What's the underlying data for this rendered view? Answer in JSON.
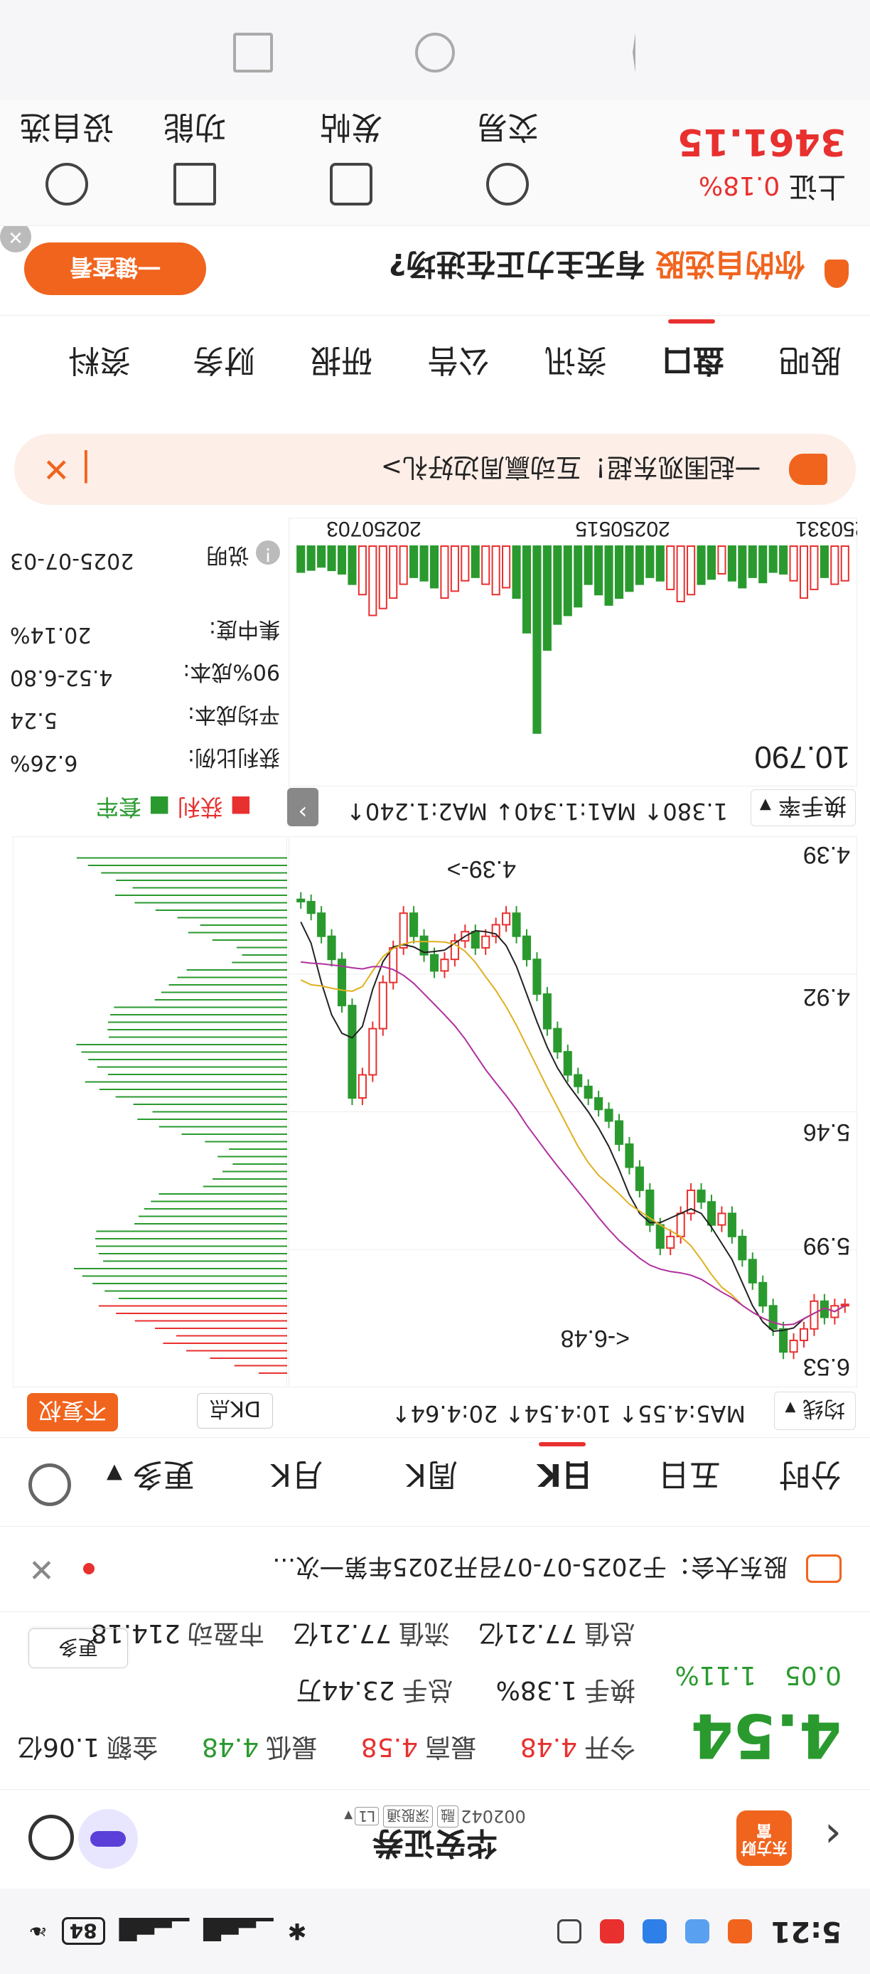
{
  "status": {
    "time": "5:21",
    "battery": "84"
  },
  "header": {
    "logo": "东方财富",
    "title": "华安证券",
    "code": "002042",
    "tags": [
      "融",
      "深股通",
      "L1"
    ],
    "back": "‹"
  },
  "quote": {
    "price": "4.54",
    "change": "0.05",
    "pct": "1.11%",
    "rows": [
      [
        [
          "今开",
          "4.48"
        ],
        [
          "最高",
          "4.58"
        ],
        [
          "最低",
          "4.48"
        ],
        [
          "金额",
          "1.06亿"
        ]
      ],
      [
        [
          "换手",
          "1.38%"
        ],
        [
          "总手",
          "23.44万"
        ],
        [
          "",
          "",
          ""
        ]
      ],
      [
        [
          "总值",
          "77.21亿"
        ],
        [
          "流值",
          "77.21亿"
        ],
        [
          "市盈动",
          "214.18"
        ]
      ]
    ],
    "more": "更多"
  },
  "notice": {
    "text": "股东大会：于2025-07-07召开2025年第一次..."
  },
  "period_tabs": {
    "items": [
      "分时",
      "五日",
      "日K",
      "周K",
      "月K",
      "更多"
    ],
    "active": "日K"
  },
  "ma": {
    "selector": "均线",
    "values": "MA5:4.55↑ 10:4.54↑ 20:4.64↑",
    "dk": "DK点",
    "fq": "不复权"
  },
  "kchart": {
    "max_label": "6.53",
    "mid1": "5.99",
    "mid2": "5.46",
    "mid3": "4.92",
    "min_label": "4.39",
    "hi_annot": "<-6.48",
    "lo_annot": "4.39->"
  },
  "chip": {
    "legend_profit": "获利",
    "legend_trap": "套牢"
  },
  "mid_row": {
    "selector": "换手率",
    "values": "1.380↑ MA1:1.340↓ MA2:1.240↑"
  },
  "vol": {
    "value": "10.790",
    "dates": [
      "20250331",
      "20250515",
      "20250703"
    ]
  },
  "chip_info": {
    "rows": [
      [
        "获利比例:",
        "6.26%"
      ],
      [
        "平均成本:",
        "5.24"
      ],
      [
        "90%成本:",
        "4.52-6.80"
      ],
      [
        "集中度:",
        "20.14%"
      ]
    ],
    "note_label": "说明",
    "note_date": "2025-07-03"
  },
  "promo": {
    "text": "一起围观东超！互动赢周边好礼>"
  },
  "info_tabs": {
    "items": [
      "股吧",
      "盘口",
      "资讯",
      "公告",
      "研报",
      "财务",
      "资料"
    ],
    "active": "盘口"
  },
  "ad": {
    "text": "你的自选股",
    "text2": "有无主力正在进场?",
    "button": "一键查看"
  },
  "bottom": {
    "index_name": "上证",
    "index_pct": "0.18%",
    "index_value": "3461.15",
    "items": [
      "交易",
      "发帖",
      "功能",
      "设自选"
    ]
  },
  "colors": {
    "up": "#e8302f",
    "down": "#2a9a2f",
    "accent": "#f0641e"
  },
  "chart_data": {
    "type": "candlestick",
    "ylim": [
      4.39,
      6.53
    ],
    "close": [
      6.3,
      6.35,
      6.28,
      6.4,
      6.45,
      6.5,
      6.4,
      6.3,
      6.2,
      6.1,
      6.0,
      5.9,
      5.95,
      5.85,
      5.8,
      5.9,
      6.0,
      6.05,
      5.95,
      5.8,
      5.7,
      5.6,
      5.5,
      5.45,
      5.4,
      5.35,
      5.3,
      5.2,
      5.1,
      4.95,
      4.8,
      4.7,
      4.6,
      4.65,
      4.7,
      4.75,
      4.68,
      4.72,
      4.8,
      4.85,
      4.78,
      4.7,
      4.6,
      4.75,
      4.9,
      5.1,
      5.3,
      5.4,
      5.0,
      4.8,
      4.7,
      4.6,
      4.55,
      4.54
    ],
    "volume": [
      2,
      2.2,
      1.8,
      2.5,
      3,
      2,
      1.6,
      1.5,
      2.1,
      1.8,
      2.4,
      2,
      1.6,
      1.9,
      2.2,
      2.8,
      3.2,
      2.5,
      2,
      1.8,
      2.2,
      2.6,
      3,
      3.4,
      2.8,
      2.2,
      3.5,
      4,
      4.5,
      6,
      10.79,
      5,
      3,
      2.4,
      2.8,
      2.2,
      1.8,
      2,
      2.6,
      3,
      2.4,
      2,
      1.8,
      2.2,
      3,
      3.6,
      4,
      2.8,
      2.2,
      1.6,
      1.4,
      1.2,
      1.38,
      1.5
    ]
  }
}
